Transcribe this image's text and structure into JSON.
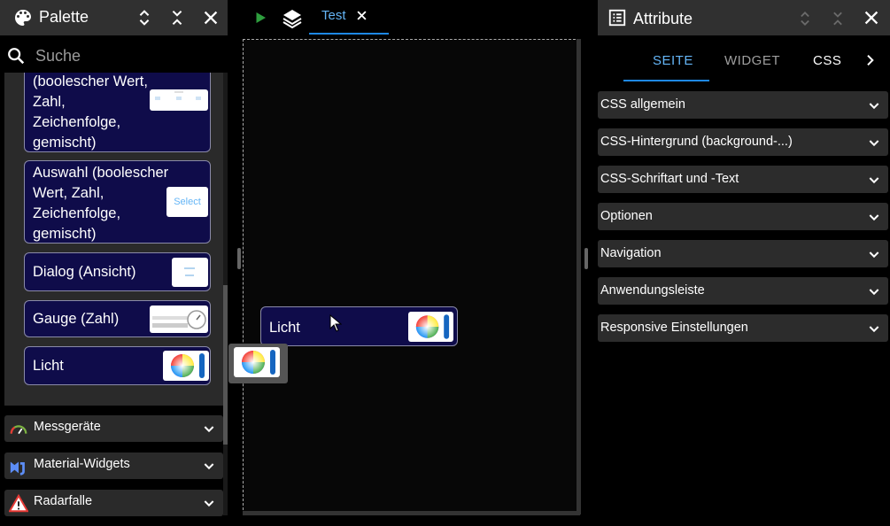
{
  "palette": {
    "title": "Palette",
    "search_placeholder": "Suche",
    "cards": [
      {
        "label": "(boolescher Wert, Zahl, Zeichenfolge, gemischt)"
      },
      {
        "label": "Auswahl (boolescher Wert, Zahl, Zeichenfolge, gemischt)",
        "thumb_text": "Select"
      },
      {
        "label": "Dialog (Ansicht)"
      },
      {
        "label": "Gauge (Zahl)"
      },
      {
        "label": "Licht"
      }
    ],
    "categories": [
      {
        "label": "Messgeräte",
        "icon": "gauge-icon"
      },
      {
        "label": "Material-Widgets",
        "icon": "material-icon"
      },
      {
        "label": "Radarfalle",
        "icon": "warning-icon"
      }
    ]
  },
  "editor": {
    "tab_label": "Test",
    "widget_label": "Licht"
  },
  "attributes": {
    "title": "Attribute",
    "tabs": [
      "SEITE",
      "WIDGET",
      "CSS"
    ],
    "active_tab": "SEITE",
    "sections": [
      "CSS allgemein",
      "CSS-Hintergrund (background-...)",
      "CSS-Schriftart und -Text",
      "Optionen",
      "Navigation",
      "Anwendungsleiste",
      "Responsive Einstellungen"
    ]
  },
  "colors": {
    "accent": "#1e88e5",
    "tab_active_text": "#64b5f6",
    "card_bg": "#0f0c4a",
    "play_green": "#2e9e3e"
  }
}
